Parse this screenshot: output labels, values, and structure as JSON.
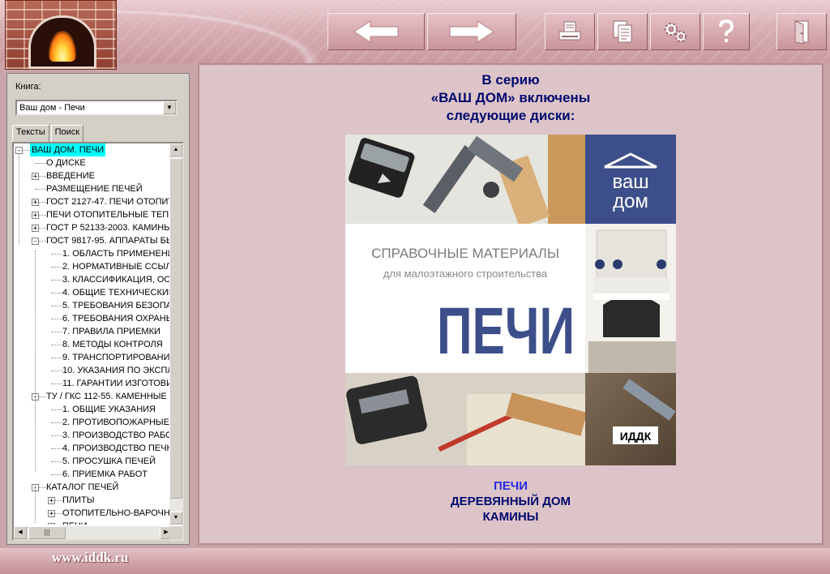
{
  "toolbar": {
    "buttons": [
      {
        "name": "back",
        "icon": "arrow-left-icon"
      },
      {
        "name": "forward",
        "icon": "arrow-right-icon"
      },
      {
        "name": "print",
        "icon": "printer-icon"
      },
      {
        "name": "copy",
        "icon": "copy-icon"
      },
      {
        "name": "settings",
        "icon": "gears-icon"
      },
      {
        "name": "help",
        "icon": "question-icon"
      },
      {
        "name": "exit",
        "icon": "door-exit-icon"
      }
    ]
  },
  "sidebar": {
    "book_label": "Книга:",
    "book_value": "Ваш дом - Печи",
    "tabs": [
      "Тексты",
      "Поиск"
    ],
    "active_tab": 0,
    "tree": [
      {
        "label": "ВАШ ДОМ. ПЕЧИ",
        "level": 0,
        "expander": "-",
        "selected": true
      },
      {
        "label": "О ДИСКЕ",
        "level": 1,
        "expander": ""
      },
      {
        "label": "ВВЕДЕНИЕ",
        "level": 1,
        "expander": "+"
      },
      {
        "label": "РАЗМЕЩЕНИЕ ПЕЧЕЙ",
        "level": 1,
        "expander": ""
      },
      {
        "label": "ГОСТ 2127-47. ПЕЧИ ОТОПИТ",
        "level": 1,
        "expander": "+"
      },
      {
        "label": "ПЕЧИ ОТОПИТЕЛЬНЫЕ ТЕП",
        "level": 1,
        "expander": "+"
      },
      {
        "label": "ГОСТ Р 52133-2003. КАМИНЫ",
        "level": 1,
        "expander": "+"
      },
      {
        "label": "ГОСТ 9817-95. АППАРАТЫ БЫ",
        "level": 1,
        "expander": "-"
      },
      {
        "label": "1. ОБЛАСТЬ ПРИМЕНЕНИ",
        "level": 2,
        "expander": ""
      },
      {
        "label": "2. НОРМАТИВНЫЕ ССЫЛ",
        "level": 2,
        "expander": ""
      },
      {
        "label": "3. КЛАССИФИКАЦИЯ, ОС",
        "level": 2,
        "expander": ""
      },
      {
        "label": "4. ОБЩИЕ ТЕХНИЧЕСКИЕ",
        "level": 2,
        "expander": ""
      },
      {
        "label": "5. ТРЕБОВАНИЯ БЕЗОПА",
        "level": 2,
        "expander": ""
      },
      {
        "label": "6. ТРЕБОВАНИЯ ОХРАНЬ",
        "level": 2,
        "expander": ""
      },
      {
        "label": "7. ПРАВИЛА ПРИЕМКИ",
        "level": 2,
        "expander": ""
      },
      {
        "label": "8. МЕТОДЫ КОНТРОЛЯ",
        "level": 2,
        "expander": ""
      },
      {
        "label": "9. ТРАНСПОРТИРОВАНИ",
        "level": 2,
        "expander": ""
      },
      {
        "label": "10. УКАЗАНИЯ ПО ЭКСПЛ",
        "level": 2,
        "expander": ""
      },
      {
        "label": "11. ГАРАНТИИ ИЗГОТОВИ",
        "level": 2,
        "expander": ""
      },
      {
        "label": "ТУ / ГКС 112-55. КАМЕННЫЕ",
        "level": 1,
        "expander": "-"
      },
      {
        "label": "1. ОБЩИЕ УКАЗАНИЯ",
        "level": 2,
        "expander": ""
      },
      {
        "label": "2. ПРОТИВОПОЖАРНЫЕ",
        "level": 2,
        "expander": ""
      },
      {
        "label": "3. ПРОИЗВОДСТВО РАБС",
        "level": 2,
        "expander": ""
      },
      {
        "label": "4. ПРОИЗВОДСТВО ПЕЧН",
        "level": 2,
        "expander": ""
      },
      {
        "label": "5. ПРОСУШКА ПЕЧЕЙ",
        "level": 2,
        "expander": ""
      },
      {
        "label": "6. ПРИЕМКА РАБОТ",
        "level": 2,
        "expander": ""
      },
      {
        "label": "КАТАЛОГ ПЕЧЕЙ",
        "level": 1,
        "expander": "-"
      },
      {
        "label": "ПЛИТЫ",
        "level": 2,
        "expander": "+"
      },
      {
        "label": "ОТОПИТЕЛЬНО-ВАРОЧН",
        "level": 2,
        "expander": "+"
      },
      {
        "label": "ПЕЧИ",
        "level": 2,
        "expander": "+"
      }
    ]
  },
  "main": {
    "heading": [
      "В серию",
      "«ВАШ ДОМ» включены",
      "следующие диски:"
    ],
    "cover": {
      "series_logo_line1": "ваш",
      "series_logo_line2": "дом",
      "subtitle_line1": "СПРАВОЧНЫЕ МАТЕРИАЛЫ",
      "subtitle_line2": "для малоэтажного строительства",
      "title": "ПЕЧИ",
      "publisher": "ИДДК"
    },
    "discs": [
      "ПЕЧИ",
      "ДЕРЕВЯННЫЙ ДОМ",
      "КАМИНЫ"
    ]
  },
  "footer": {
    "website": "www.iddk.ru"
  },
  "colors": {
    "heading": "#000a6e",
    "disc_highlight": "#2a2ae0",
    "cover_blue": "#3d4f8a",
    "tree_selected": "#00ffff"
  }
}
